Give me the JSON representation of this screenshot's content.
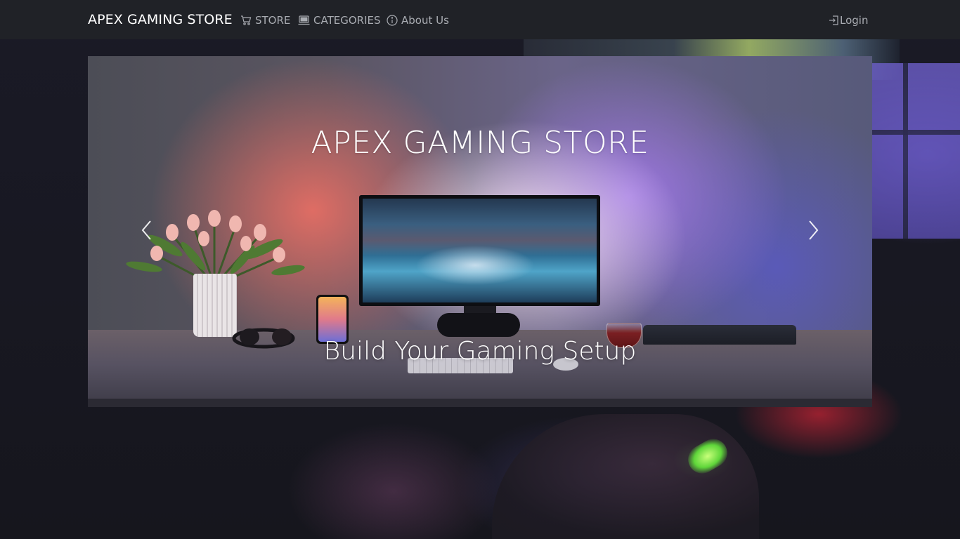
{
  "navbar": {
    "brand": "APEX GAMING STORE",
    "links": [
      {
        "label": "STORE",
        "icon": "cart-icon"
      },
      {
        "label": "CATEGORIES",
        "icon": "laptop-icon"
      },
      {
        "label": "About Us",
        "icon": "info-icon"
      }
    ],
    "login": {
      "label": "Login",
      "icon": "login-icon"
    }
  },
  "carousel": {
    "slides": [
      {
        "title": "APEX GAMING STORE",
        "subtitle": "Build Your Gaming Setup"
      }
    ],
    "prev_icon": "chevron-left-icon",
    "next_icon": "chevron-right-icon"
  },
  "colors": {
    "navbar_bg": "#202227",
    "nav_text": "#a9acb2",
    "brand_text": "#ffffff",
    "page_bg": "#15161b"
  }
}
